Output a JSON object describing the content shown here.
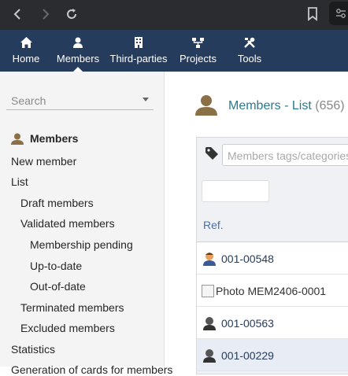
{
  "browser": {
    "back_icon": "chevron-left-icon",
    "forward_icon": "chevron-right-icon",
    "reload_icon": "reload-icon",
    "bookmark_icon": "bookmark-icon",
    "extension_icon": "extension-icon"
  },
  "topmenu": {
    "items": [
      {
        "label": "Home",
        "icon": "home-icon"
      },
      {
        "label": "Members",
        "icon": "user-icon",
        "active": true
      },
      {
        "label": "Third-parties",
        "icon": "building-icon"
      },
      {
        "label": "Projects",
        "icon": "sitemap-icon"
      },
      {
        "label": "Tools",
        "icon": "tools-icon"
      }
    ],
    "bg_color": "#263c5c"
  },
  "sidebar": {
    "search_placeholder": "Search",
    "title": "Members",
    "items": [
      {
        "label": "New member"
      },
      {
        "label": "List"
      },
      {
        "label": "Draft members"
      },
      {
        "label": "Validated members"
      },
      {
        "label": "Membership pending"
      },
      {
        "label": "Up-to-date"
      },
      {
        "label": "Out-of-date"
      },
      {
        "label": "Terminated members"
      },
      {
        "label": "Excluded members"
      },
      {
        "label": "Statistics"
      },
      {
        "label": "Generation of cards for members"
      }
    ]
  },
  "main": {
    "title": "Members - List",
    "count": "(656)",
    "tags_placeholder": "Members tags/categories",
    "column_ref": "Ref.",
    "rows": [
      {
        "ref": "001-00548",
        "type": "avatar"
      },
      {
        "ref": "Photo MEM2406-0001",
        "type": "broken-photo"
      },
      {
        "ref": "001-00563",
        "type": "avatar-dark"
      },
      {
        "ref": "001-00229",
        "type": "avatar-dark",
        "highlight": true
      }
    ],
    "accent": "#2b7a8e",
    "link_color": "#263c5c"
  }
}
